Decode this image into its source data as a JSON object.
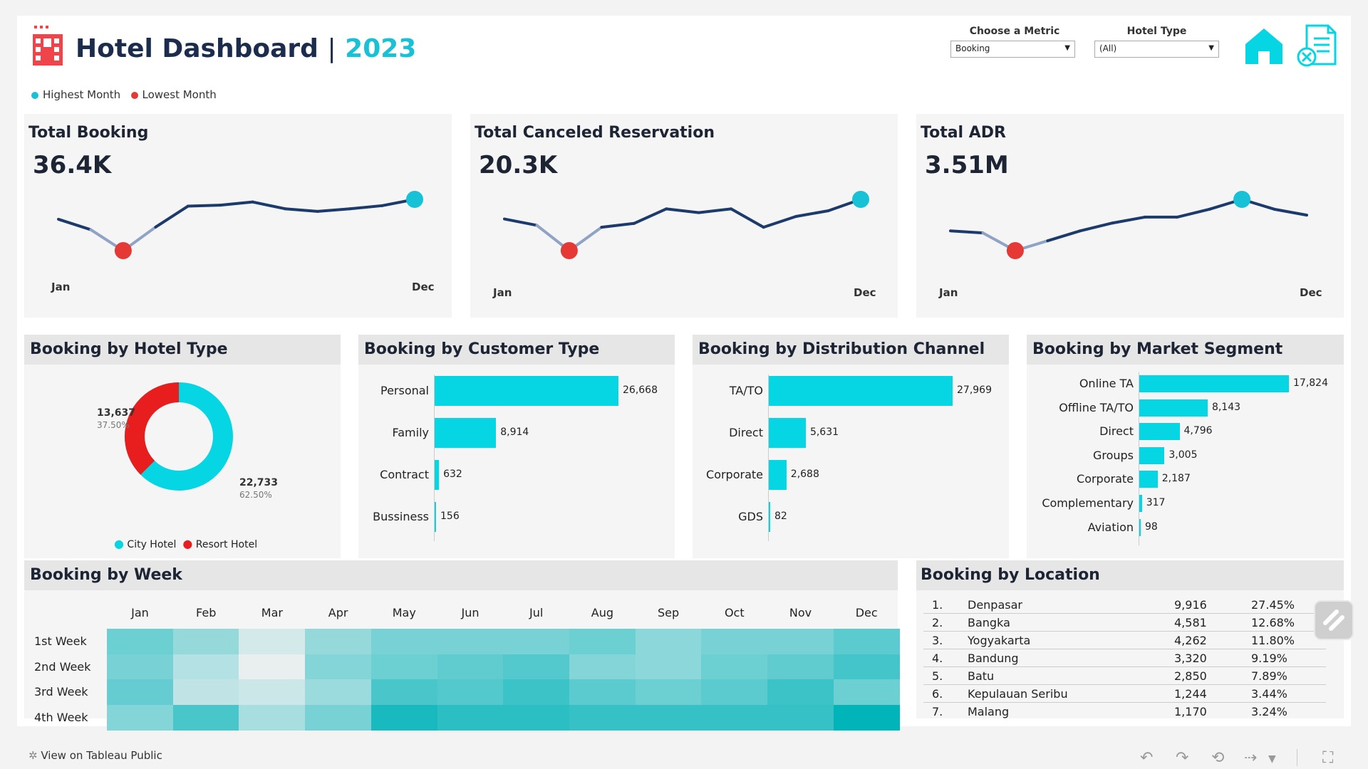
{
  "header": {
    "title": "Hotel Dashboard",
    "separator": "|",
    "year": "2023",
    "legend_high": "Highest Month",
    "legend_low": "Lowest Month",
    "metric_label": "Choose a Metric",
    "metric_value": "Booking",
    "hotel_type_label": "Hotel Type",
    "hotel_type_value": "(All)"
  },
  "colors": {
    "accent": "#06d5e3",
    "highlight": "#17c2d6",
    "low": "#e53935",
    "line": "#1c3a6b",
    "title": "#1c2c4d"
  },
  "icons": {
    "logo": "hotel-building-icon",
    "home": "home-icon",
    "report": "report-cancel-icon"
  },
  "kpis": [
    {
      "title": "Total Booking",
      "value": "36.4K",
      "start_label": "Jan",
      "end_label": "Dec",
      "series": [
        3000,
        2800,
        2400,
        2850,
        3250,
        3270,
        3330,
        3200,
        3150,
        3200,
        3260,
        3380
      ]
    },
    {
      "title": "Total Canceled Reservation",
      "value": "20.3K",
      "start_label": "Jan",
      "end_label": "Dec",
      "series": [
        1650,
        1550,
        1150,
        1520,
        1580,
        1810,
        1750,
        1810,
        1520,
        1690,
        1780,
        1960
      ]
    },
    {
      "title": "Total ADR",
      "value": "3.51M",
      "start_label": "Jan",
      "end_label": "Dec",
      "series": [
        280,
        275,
        230,
        255,
        280,
        300,
        315,
        315,
        335,
        360,
        335,
        320
      ]
    }
  ],
  "hotel_type": {
    "title": "Booking by Hotel Type",
    "resort_value": "13,637",
    "resort_pct": "37.50%",
    "city_value": "22,733",
    "city_pct": "62.50%",
    "resort_fraction": 0.375,
    "legend_city": "City Hotel",
    "legend_resort": "Resort Hotel"
  },
  "customer_type": {
    "title": "Booking by Customer Type",
    "max": 26668,
    "items": [
      {
        "label": "Personal",
        "value": 26668,
        "display": "26,668"
      },
      {
        "label": "Family",
        "value": 8914,
        "display": "8,914"
      },
      {
        "label": "Contract",
        "value": 632,
        "display": "632"
      },
      {
        "label": "Bussiness",
        "value": 156,
        "display": "156"
      }
    ]
  },
  "distribution": {
    "title": "Booking by Distribution Channel",
    "max": 27969,
    "items": [
      {
        "label": "TA/TO",
        "value": 27969,
        "display": "27,969"
      },
      {
        "label": "Direct",
        "value": 5631,
        "display": "5,631"
      },
      {
        "label": "Corporate",
        "value": 2688,
        "display": "2,688"
      },
      {
        "label": "GDS",
        "value": 82,
        "display": "82"
      }
    ]
  },
  "market_segment": {
    "title": "Booking by Market Segment",
    "max": 17824,
    "items": [
      {
        "label": "Online TA",
        "value": 17824,
        "display": "17,824"
      },
      {
        "label": "Offline TA/TO",
        "value": 8143,
        "display": "8,143"
      },
      {
        "label": "Direct",
        "value": 4796,
        "display": "4,796"
      },
      {
        "label": "Groups",
        "value": 3005,
        "display": "3,005"
      },
      {
        "label": "Corporate",
        "value": 2187,
        "display": "2,187"
      },
      {
        "label": "Complementary",
        "value": 317,
        "display": "317"
      },
      {
        "label": "Aviation",
        "value": 98,
        "display": "98"
      }
    ]
  },
  "week": {
    "title": "Booking by Week",
    "months": [
      "Jan",
      "Feb",
      "Mar",
      "Apr",
      "May",
      "Jun",
      "Jul",
      "Aug",
      "Sep",
      "Oct",
      "Nov",
      "Dec"
    ],
    "weeks": [
      "1st Week",
      "2nd Week",
      "3rd Week",
      "4th Week"
    ],
    "intensity": [
      [
        0.55,
        0.38,
        0.12,
        0.38,
        0.5,
        0.5,
        0.5,
        0.55,
        0.42,
        0.5,
        0.5,
        0.62
      ],
      [
        0.5,
        0.25,
        0.03,
        0.45,
        0.55,
        0.6,
        0.65,
        0.45,
        0.42,
        0.55,
        0.6,
        0.72
      ],
      [
        0.58,
        0.2,
        0.15,
        0.35,
        0.7,
        0.65,
        0.75,
        0.62,
        0.55,
        0.62,
        0.75,
        0.55
      ],
      [
        0.45,
        0.7,
        0.3,
        0.5,
        0.9,
        0.82,
        0.82,
        0.78,
        0.78,
        0.78,
        0.78,
        1.0
      ]
    ]
  },
  "location": {
    "title": "Booking by Location",
    "rows": [
      {
        "rank": "1.",
        "name": "Denpasar",
        "value": "9,916",
        "pct": "27.45%"
      },
      {
        "rank": "2.",
        "name": "Bangka",
        "value": "4,581",
        "pct": "12.68%"
      },
      {
        "rank": "3.",
        "name": "Yogyakarta",
        "value": "4,262",
        "pct": "11.80%"
      },
      {
        "rank": "4.",
        "name": "Bandung",
        "value": "3,320",
        "pct": "9.19%"
      },
      {
        "rank": "5.",
        "name": "Batu",
        "value": "2,850",
        "pct": "7.89%"
      },
      {
        "rank": "6.",
        "name": "Kepulauan Seribu",
        "value": "1,244",
        "pct": "3.44%"
      },
      {
        "rank": "7.",
        "name": "Malang",
        "value": "1,170",
        "pct": "3.24%"
      }
    ]
  },
  "footer": {
    "view_label": "View on Tableau Public"
  }
}
